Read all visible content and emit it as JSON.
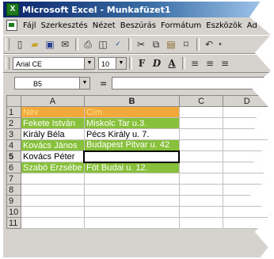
{
  "title": "Microsoft Excel - Munkafüzet1",
  "menu": [
    "Fájl",
    "Szerkesztés",
    "Nézet",
    "Beszúrás",
    "Formátum",
    "Eszközök",
    "Ad"
  ],
  "font": {
    "name": "Arial CE",
    "size": "10"
  },
  "format_buttons": [
    "F",
    "D",
    "A"
  ],
  "name_box": "B5",
  "formula_label": "=",
  "columns": [
    "A",
    "B",
    "C",
    "D"
  ],
  "rows": [
    {
      "n": "1",
      "a": "Név",
      "b": "Cím"
    },
    {
      "n": "2",
      "a": "Fekete István",
      "b": "Miskolc Tar u.3."
    },
    {
      "n": "3",
      "a": "Király Béla",
      "b": "Pécs Király u. 7."
    },
    {
      "n": "4",
      "a": "Kovács János",
      "b": "Budapest Pitvar u. 42"
    },
    {
      "n": "5",
      "a": "Kovács Péter",
      "b": ""
    },
    {
      "n": "6",
      "a": "Szabó Erzsébe",
      "b": "Fót Budai u. 12."
    },
    {
      "n": "7",
      "a": "",
      "b": ""
    },
    {
      "n": "8",
      "a": "",
      "b": ""
    },
    {
      "n": "9",
      "a": "",
      "b": ""
    },
    {
      "n": "10",
      "a": "",
      "b": ""
    },
    {
      "n": "11",
      "a": "",
      "b": ""
    }
  ],
  "colors": {
    "header_fill": "#f2a93b",
    "green_fill": "#87c03a"
  }
}
